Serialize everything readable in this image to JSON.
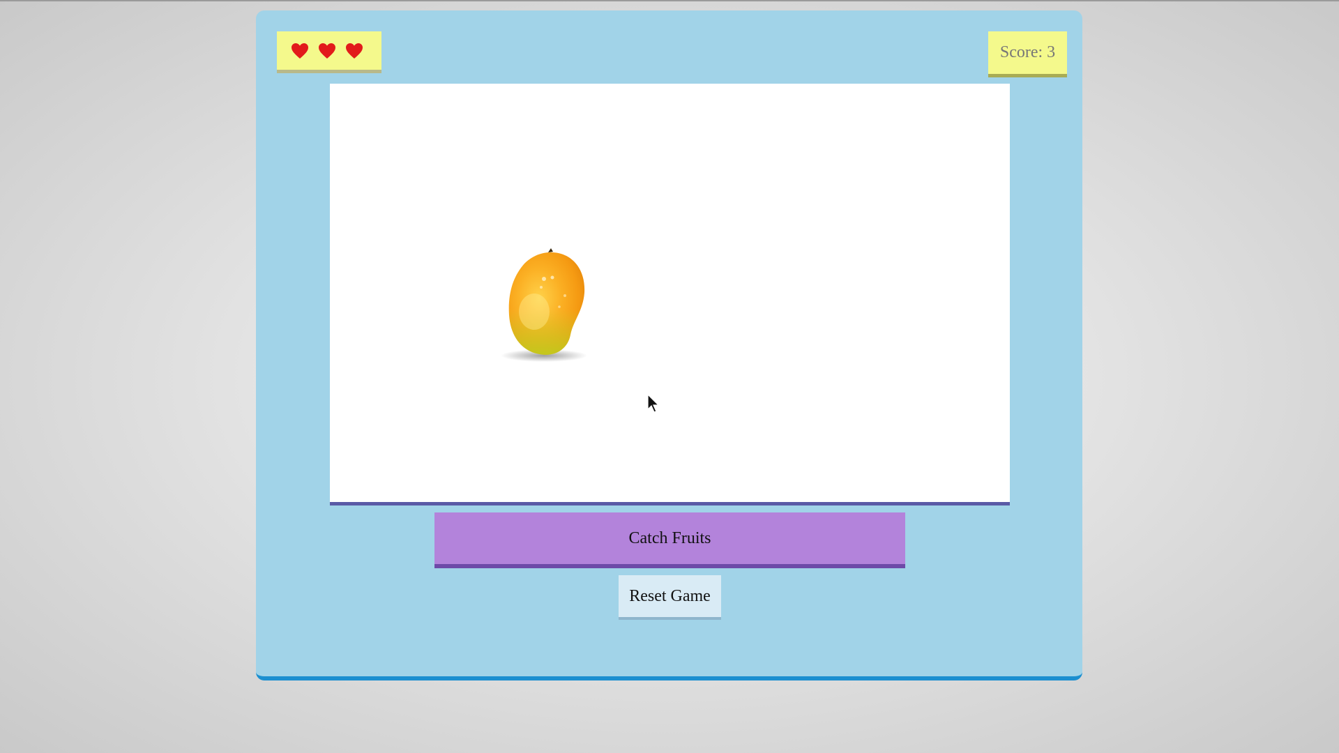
{
  "game": {
    "lives": {
      "count": 3,
      "icon": "heart-icon",
      "color": "#e21b1b"
    },
    "score_label": "Score: 3",
    "fruit": {
      "icon": "mango-icon"
    },
    "catch_label": "Catch Fruits",
    "reset_label": "Reset Game"
  },
  "colors": {
    "frame": "#a1d3e8",
    "frame_border": "#1b8fd0",
    "panel_yellow": "#f4f98c",
    "catch_button": "#b383db",
    "reset_button": "#d9ebf5"
  }
}
